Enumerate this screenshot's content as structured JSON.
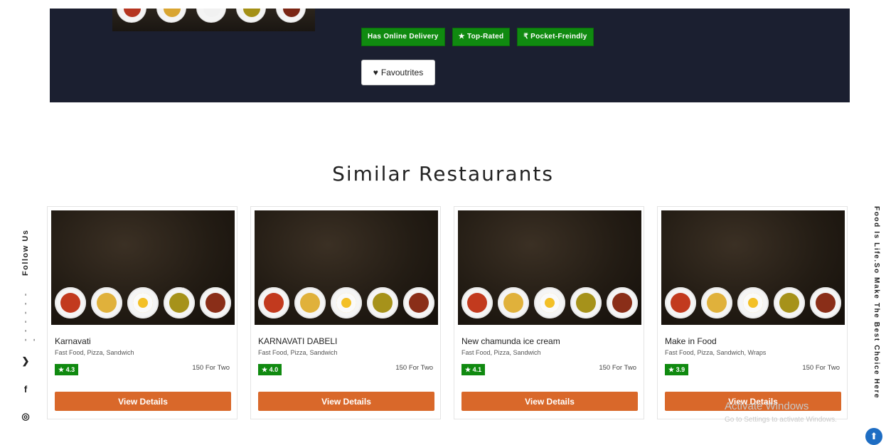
{
  "hero": {
    "tags": [
      {
        "label": "Has Online Delivery"
      },
      {
        "label": "★ Top-Rated"
      },
      {
        "label": "₹ Pocket-Freindly"
      }
    ],
    "favourites_label": "Favoutrites",
    "favourites_icon": "heart-icon"
  },
  "section_title": "Similar Restaurants",
  "cards": [
    {
      "name": "Karnavati",
      "cuisine": "Fast Food, Pizza, Sandwich",
      "rating": "★ 4.3",
      "cost": "150 For Two",
      "button": "View Details"
    },
    {
      "name": "KARNAVATI DABELI",
      "cuisine": "Fast Food, Pizza, Sandwich",
      "rating": "★ 4.0",
      "cost": "150 For Two",
      "button": "View Details"
    },
    {
      "name": "New chamunda ice cream",
      "cuisine": "Fast Food, Pizza, Sandwich",
      "rating": "★ 4.1",
      "cost": "150 For Two",
      "button": "View Details"
    },
    {
      "name": "Make in Food",
      "cuisine": "Fast Food, Pizza, Sandwich, Wraps",
      "rating": "★ 3.9",
      "cost": "150 For Two",
      "button": "View Details"
    }
  ],
  "sidebar": {
    "follow_label": "Follow Us",
    "dots": "- - - - - - -",
    "social": [
      {
        "icon": "twitter-icon",
        "glyph": "❯"
      },
      {
        "icon": "facebook-icon",
        "glyph": "f"
      },
      {
        "icon": "instagram-icon",
        "glyph": "◎"
      }
    ]
  },
  "tagline": "Food Is Life.So Make The Best Choice Here",
  "watermark": {
    "line1": "Activate Windows",
    "line2": "Go to Settings to activate Windows."
  },
  "scroll_top_icon": "arrow-up-icon",
  "colors": {
    "hero_bg": "#1b1f30",
    "tag_green": "#108a10",
    "button_orange": "#d9682a",
    "scroll_blue": "#1e6dc3"
  }
}
